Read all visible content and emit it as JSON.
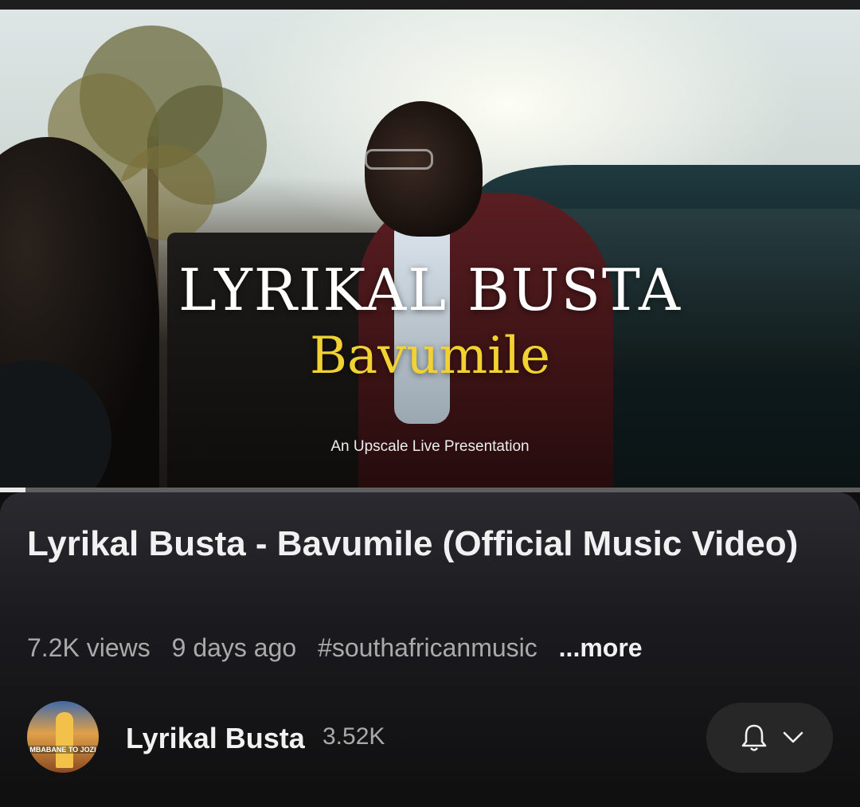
{
  "video": {
    "overlay_title": "LYRIKAL BUSTA",
    "overlay_subtitle": "Bavumile",
    "overlay_presentation": "An Upscale Live Presentation",
    "progress_fraction": 0.03
  },
  "details": {
    "title": "Lyrikal Busta - Bavumile (Official Music Video)",
    "views": "7.2K views",
    "age": "9 days ago",
    "hashtag": "#southafricanmusic",
    "more": "...more"
  },
  "channel": {
    "name": "Lyrikal Busta",
    "subscribers": "3.52K",
    "avatar_text": "MBABANE TO JOZI"
  },
  "icons": {
    "bell": "bell-icon",
    "chevron": "chevron-down-icon"
  },
  "colors": {
    "background": "#0f0f0f",
    "overlay_subtitle": "#f1d232",
    "secondary_text": "#aaaaaa"
  }
}
